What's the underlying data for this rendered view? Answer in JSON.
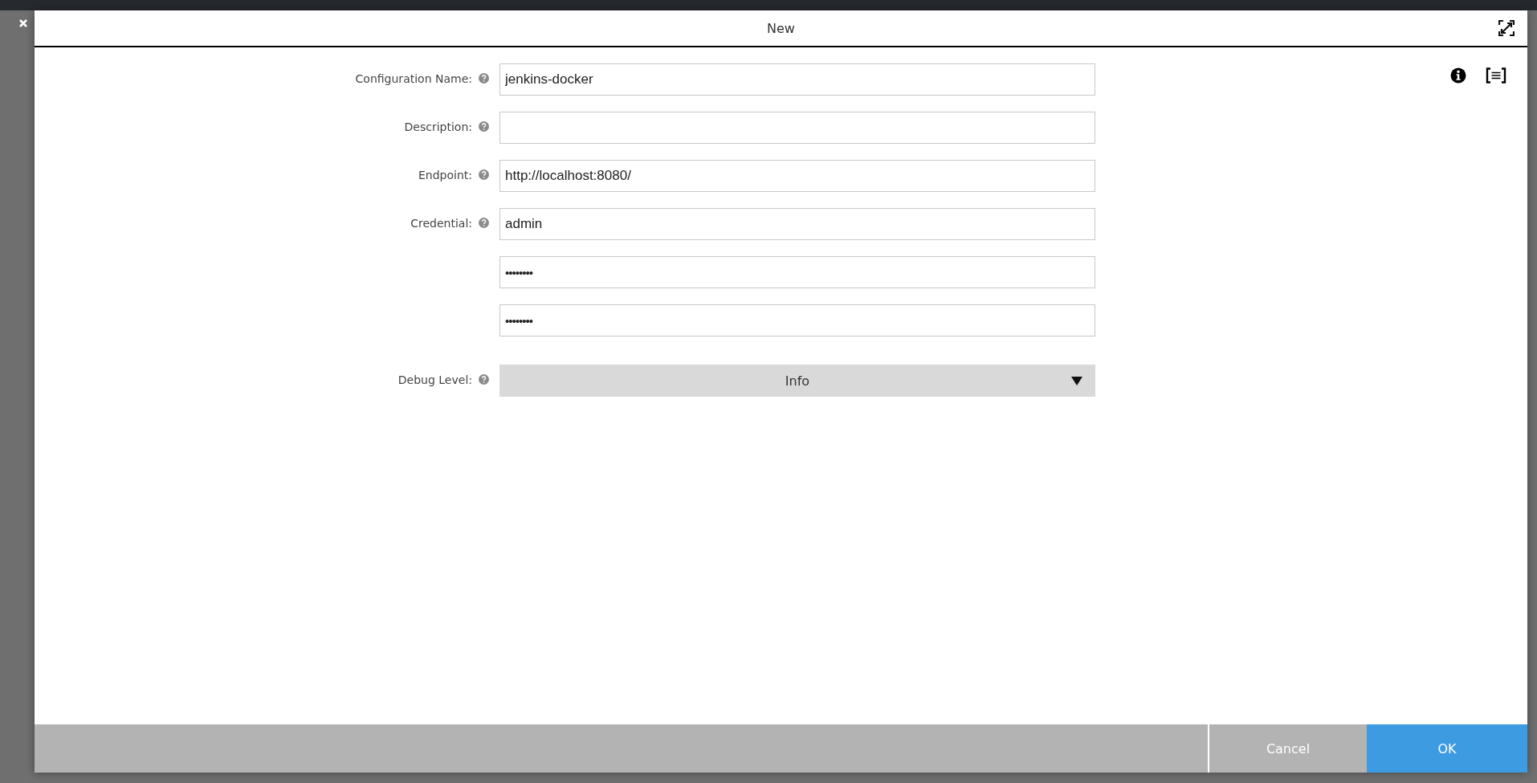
{
  "dialog": {
    "title": "New"
  },
  "fields": [
    {
      "label": "Configuration Name:",
      "inputs": [
        {
          "kind": "text",
          "value": "jenkins-docker"
        }
      ]
    },
    {
      "label": "Description:",
      "inputs": [
        {
          "kind": "text"
        }
      ]
    },
    {
      "label": "Endpoint:",
      "inputs": [
        {
          "kind": "text",
          "value": "http://localhost:8080/"
        }
      ]
    },
    {
      "label": "Credential:",
      "inputs": [
        {
          "kind": "text",
          "value": "admin"
        },
        {
          "kind": "password",
          "value": "••••••••"
        },
        {
          "kind": "password",
          "value": "••••••••"
        }
      ]
    },
    {
      "label": "Debug Level:",
      "inputs": [
        {
          "kind": "select",
          "value": "Info"
        }
      ]
    }
  ],
  "buttons": [
    {
      "label": "Cancel",
      "primary": false
    },
    {
      "label": "OK",
      "primary": true
    }
  ]
}
